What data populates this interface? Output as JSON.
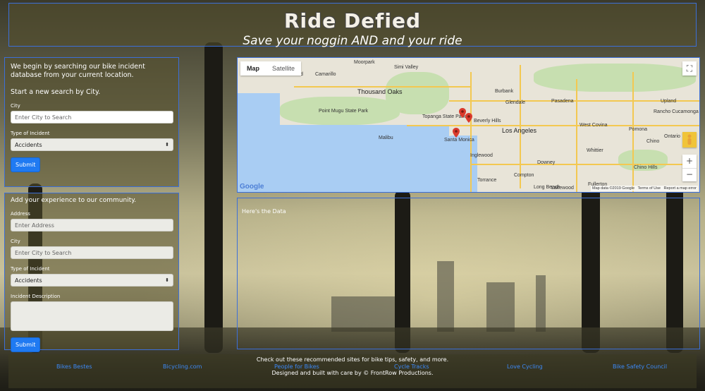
{
  "header": {
    "title": "Ride Defied",
    "subtitle": "Save your noggin AND and your ride"
  },
  "search": {
    "intro": "We begin by searching our bike incident database from your current location.",
    "start_text": "Start a new search by City.",
    "city_label": "City",
    "city_placeholder": "Enter City to Search",
    "type_label": "Type of Incident",
    "type_value": "Accidents",
    "submit_label": "Submit"
  },
  "report": {
    "heading": "Add your experience to our community.",
    "address_label": "Address",
    "address_placeholder": "Enter Address",
    "city_label": "City",
    "city_placeholder": "Enter City to Search",
    "type_label": "Type of Incident",
    "type_value": "Accidents",
    "description_label": "Incident Description",
    "submit_label": "Submit"
  },
  "map": {
    "tab_map": "Map",
    "tab_satellite": "Satellite",
    "fullscreen_icon": "fullscreen-icon",
    "zoom_in": "+",
    "zoom_out": "−",
    "pegman_icon": "pegman-icon",
    "google_logo": "Google",
    "attribution": {
      "data": "Map data ©2019 Google",
      "terms": "Terms of Use",
      "report": "Report a map error"
    },
    "places": [
      "Moorpark",
      "Simi Valley",
      "Thousand Oaks",
      "Burbank",
      "Glendale",
      "Pasadena",
      "Beverly Hills",
      "Los Angeles",
      "West Covina",
      "Santa Monica",
      "Inglewood",
      "Downey",
      "Pomona",
      "Ontario",
      "Compton",
      "Long Beach",
      "Torrance",
      "Fullerton",
      "Lakewood",
      "Chino",
      "Chino Hills",
      "Rancho Cucamonga",
      "Topanga State Park",
      "Point Mugu State Park",
      "Malibu",
      "Oxnard",
      "Camarillo",
      "Upland",
      "Whittier"
    ]
  },
  "results": {
    "heading": "Here's the Data"
  },
  "footer": {
    "message": "Check out these recommended sites for bike tips, safety, and more.",
    "links": [
      "Bikes Bestes",
      "Bicycling.com",
      "People for Bikes",
      "Cycle Tracks",
      "Love Cycling",
      "Bike Safety Council"
    ],
    "credit": "Designed and built with care by © FrontRow Productions."
  },
  "colors": {
    "accent": "#1f7af2",
    "panel_border": "#3c6fd8",
    "link": "#3c88f5",
    "marker": "#d93a2c"
  }
}
